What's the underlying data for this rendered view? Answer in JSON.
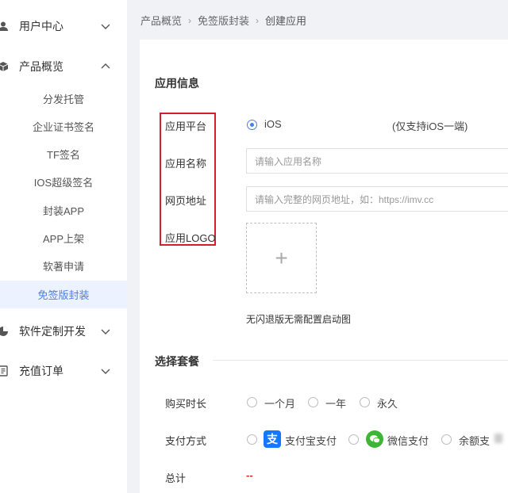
{
  "sidebar": {
    "groups": [
      {
        "label": "用户中心",
        "icon": "user-icon",
        "expanded": false
      },
      {
        "label": "产品概览",
        "icon": "cube-icon",
        "expanded": true
      },
      {
        "label": "软件定制开发",
        "icon": "pie-chart-icon",
        "expanded": false
      },
      {
        "label": "充值订单",
        "icon": "order-list-icon",
        "expanded": false
      }
    ],
    "items": [
      "分发托管",
      "企业证书签名",
      "TF签名",
      "IOS超级签名",
      "封装APP",
      "APP上架",
      "软著申请",
      "免签版封装"
    ],
    "active_index": 7
  },
  "breadcrumb": [
    "产品概览",
    "免签版封装",
    "创建应用"
  ],
  "app_info": {
    "title": "应用信息",
    "platform_label": "应用平台",
    "platform_option": "iOS",
    "platform_note": "(仅支持iOS一端)",
    "name_label": "应用名称",
    "name_placeholder": "请输入应用名称",
    "url_label": "网页地址",
    "url_placeholder": "请输入完整的网页地址，如：https://imv.cc",
    "logo_label": "应用LOGO",
    "upload_symbol": "+",
    "hint": "无闪退版无需配置启动图"
  },
  "package": {
    "title": "选择套餐",
    "duration_label": "购买时长",
    "duration_options": [
      "一个月",
      "一年",
      "永久"
    ],
    "payment_label": "支付方式",
    "payment_options": [
      "支付宝支付",
      "微信支付",
      "余额支"
    ],
    "alipay_glyph": "支",
    "total_label": "总计",
    "total_value": "--"
  },
  "colors": {
    "accent": "#4a7fe8",
    "highlight_border": "#d11f2b",
    "alipay": "#1677ff",
    "wechat": "#3eb535"
  }
}
